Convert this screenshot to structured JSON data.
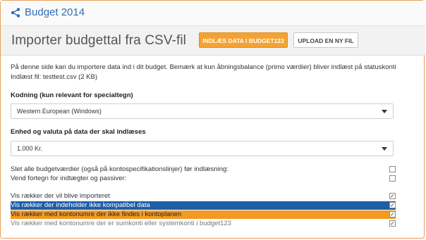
{
  "app": {
    "title": "Budget 2014"
  },
  "header": {
    "page_title": "Importer budgettal fra CSV-fil",
    "load_button": "INDLÆS DATA I BUDGET123",
    "upload_button": "UPLOAD EN NY FIL"
  },
  "intro": {
    "line1": "På denne side kan du importere data ind i dit budget. Bemærk at kun åbningsbalance (primo værdier) bliver indlæst på statuskonti",
    "line2": "Indlæst fil: testtest.csv (2 KB)"
  },
  "encoding": {
    "label": "Kodning (kun relevant for specialtegn)",
    "selected": "Western European (Windows)"
  },
  "unit": {
    "label": "Enhed og valuta på data der skal indlæses",
    "selected": "1.000 Kr."
  },
  "options": [
    {
      "label": "Slet alle budgetværdier (også på kontospecifikationslinjer) før indlæsning:",
      "checked": false
    },
    {
      "label": "Vend fortegn for indtægter og passiver:",
      "checked": false
    }
  ],
  "filters": [
    {
      "label": "Vis rækker der vil blive importeret",
      "checked": true
    },
    {
      "label": "Vis rækker der indeholder ikke kompatibel data",
      "checked": true
    },
    {
      "label": "Vis rækker med kontonumre der ikke findes i kontoplanen",
      "checked": true
    },
    {
      "label": "Vis rækker med kontonumre der er sumkonti eller systemkonti i budget123",
      "checked": true
    }
  ],
  "colors": {
    "brand": "#2f6fb4",
    "accent": "#f4a232",
    "row_blue": "#1f5ea8",
    "row_orange": "#f39a22"
  }
}
